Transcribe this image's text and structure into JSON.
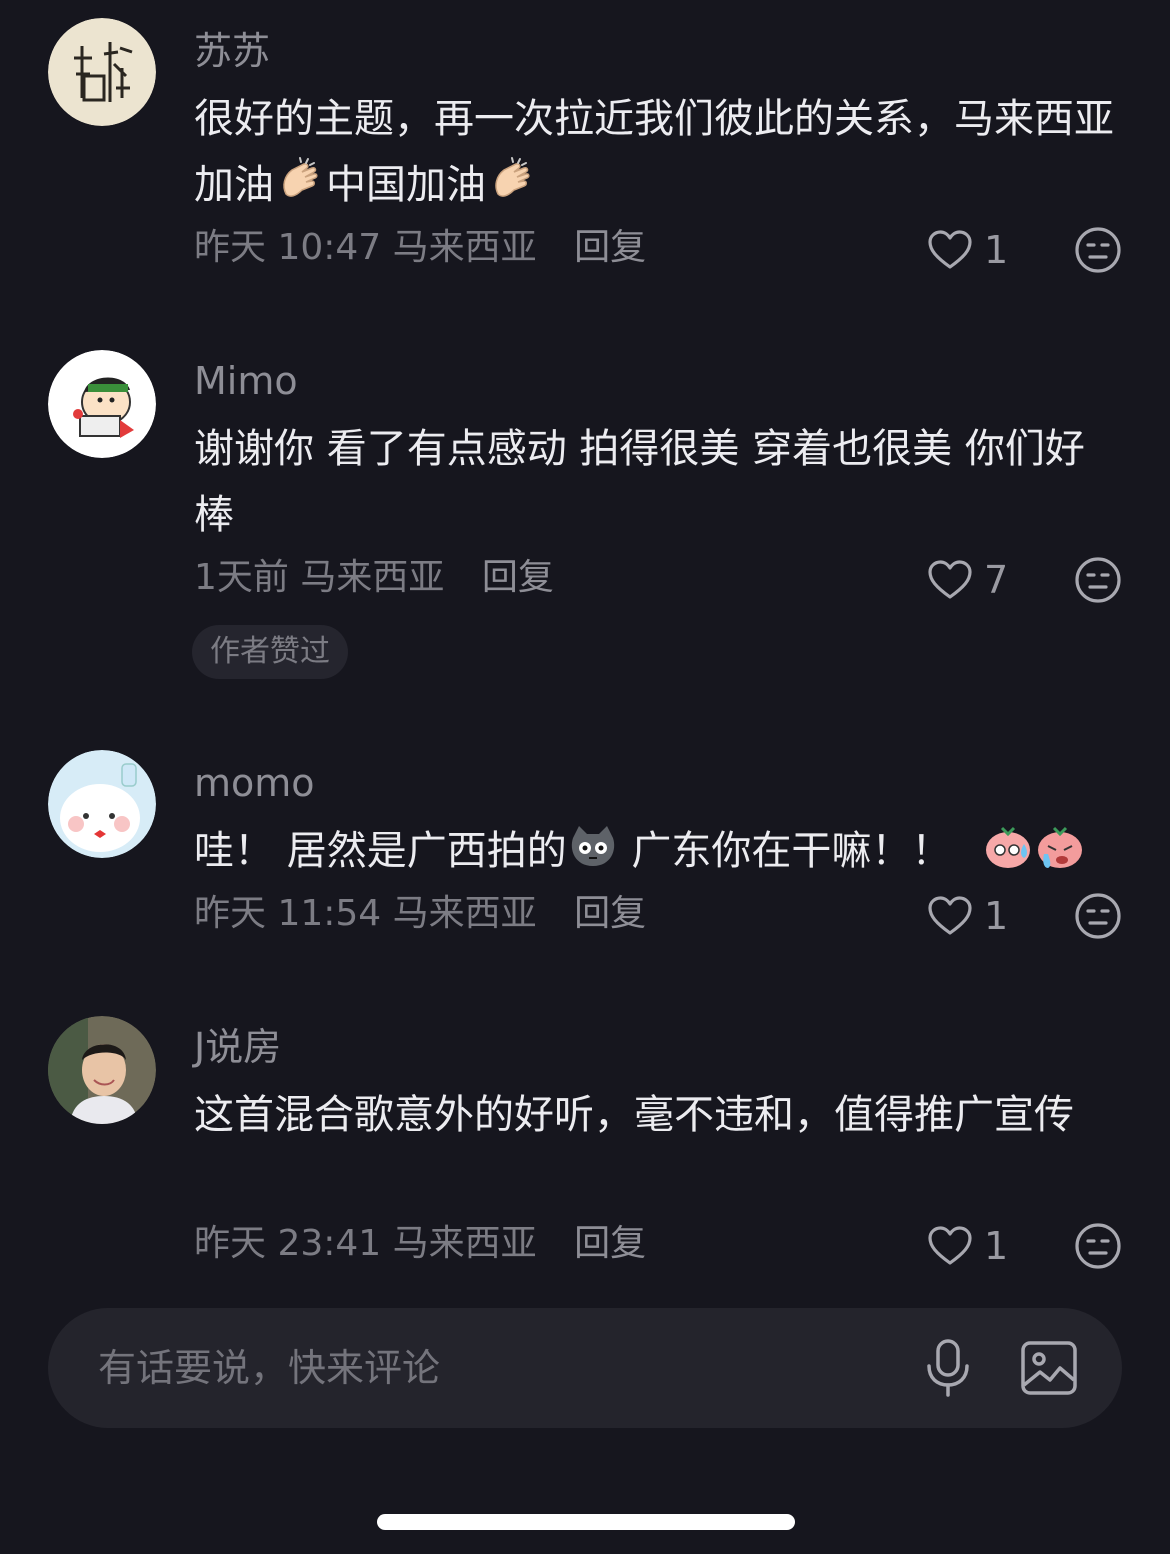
{
  "comments": [
    {
      "username": "苏苏",
      "text_before": "很好的主题，再一次拉近我们彼此的关系，马来西亚加油",
      "text_middle": "中国加油",
      "time": "昨天 10:47",
      "location": "马来西亚",
      "reply_label": "回复",
      "likes": "1",
      "avatar_icon": "seal-calligraphy-avatar",
      "emoji_icon": "clapping-hands-emoji"
    },
    {
      "username": "Mimo",
      "text": "谢谢你 看了有点感动 拍得很美 穿着也很美 你们好棒",
      "time": "1天前",
      "location": "马来西亚",
      "reply_label": "回复",
      "likes": "7",
      "badge": "作者赞过",
      "avatar_icon": "cartoon-boy-avatar"
    },
    {
      "username": "momo",
      "text_before": "哇！ 居然是广西拍的",
      "text_after": " 广东你在干嘛！！",
      "time": "昨天 11:54",
      "location": "马来西亚",
      "reply_label": "回复",
      "likes": "1",
      "avatar_icon": "white-blob-avatar",
      "emoji_icons": [
        "shocked-cat-emoji",
        "sweating-blob-emoji",
        "crying-blob-emoji"
      ]
    },
    {
      "username": "J说房",
      "text": "这首混合歌意外的好听，毫不违和，值得推广宣传",
      "time": "昨天 23:41",
      "location": "马来西亚",
      "reply_label": "回复",
      "likes": "1",
      "avatar_icon": "photo-portrait-avatar"
    }
  ],
  "input_bar": {
    "placeholder": "有话要说，快来评论",
    "mic_icon": "microphone-icon",
    "image_icon": "image-icon"
  },
  "colors": {
    "background": "#16161e",
    "text_primary": "#ececf0",
    "text_secondary": "#7c7c84",
    "input_bg": "#24242c"
  }
}
